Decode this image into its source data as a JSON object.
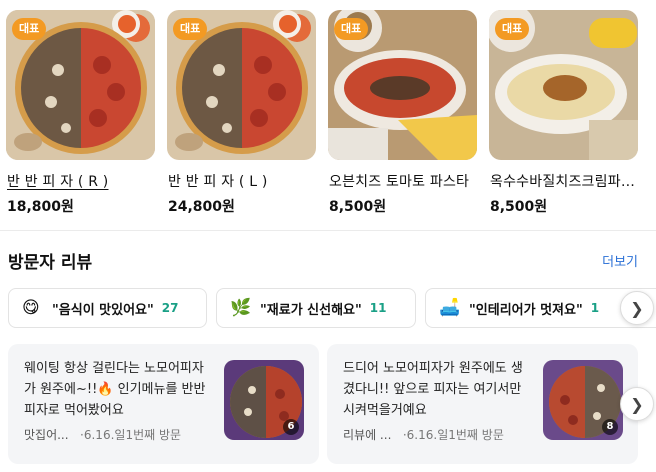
{
  "menu": {
    "badge_label": "대표",
    "items": [
      {
        "name": "반 반 피 자 ( R )",
        "price": "18,800원",
        "image": "half-half-pizza-photo"
      },
      {
        "name": "반 반 피 자 ( L )",
        "price": "24,800원",
        "image": "half-half-pizza-photo"
      },
      {
        "name": "오븐치즈 토마토 파스타",
        "price": "8,500원",
        "image": "oven-cheese-tomato-pasta-photo"
      },
      {
        "name": "옥수수바질치즈크림파스타",
        "price": "8,500원",
        "image": "corn-basil-cream-pasta-photo"
      }
    ]
  },
  "reviews": {
    "title": "방문자 리뷰",
    "more_label": "더보기",
    "keywords": [
      {
        "emoji": "😋",
        "text": "\"음식이 맛있어요\"",
        "count": "27"
      },
      {
        "emoji": "🌿",
        "text": "\"재료가 신선해요\"",
        "count": "11"
      },
      {
        "emoji": "🛋️",
        "text": "\"인테리어가 멋져요\"",
        "count": "1"
      }
    ],
    "items": [
      {
        "text": "웨이팅 항상 걸린다는 노모어피자가 원주에~!!🔥 인기메뉴를 반반피자로 먹어봤어요",
        "author": "맛집어...",
        "date": "6.16.일",
        "visit": "1번째 방문",
        "photo_count": "6"
      },
      {
        "text": "드디어 노모어피자가 원주에도 생겼다니!! 앞으로 피자는 여기서만 시켜먹을거예요",
        "author": "리뷰에 ...",
        "date": "6.16.일",
        "visit": "1번째 방문",
        "photo_count": "8"
      }
    ]
  },
  "icons": {
    "next_arrow": "chevron-right-icon"
  },
  "colors": {
    "badge": "#f39a23",
    "keyword_count": "#1aa086",
    "link": "#2a6fd6",
    "card_bg": "#f4f5f7"
  }
}
